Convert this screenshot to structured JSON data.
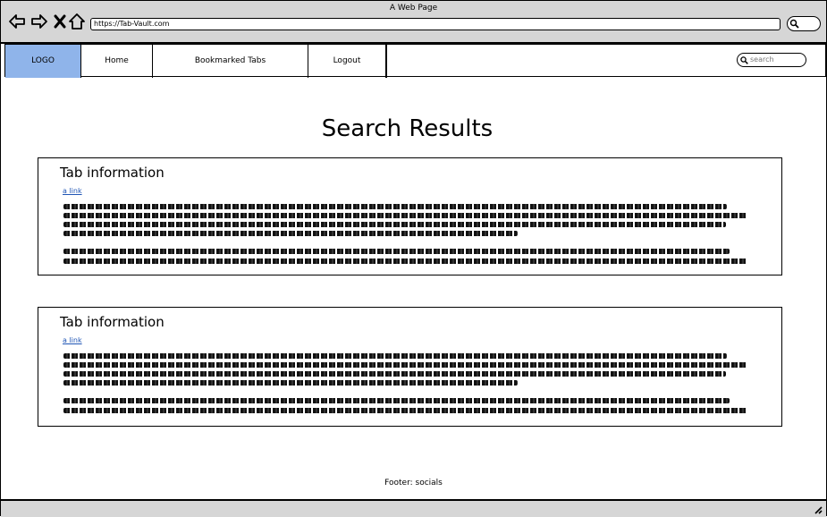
{
  "window": {
    "title": "A Web Page",
    "url": "https://Tab-Vault.com"
  },
  "nav": {
    "logo": "LOGO",
    "home": "Home",
    "bookmarked": "Bookmarked Tabs",
    "logout": "Logout",
    "search_placeholder": "search"
  },
  "main": {
    "title": "Search Results",
    "cards": [
      {
        "title": "Tab information",
        "link": "a link"
      },
      {
        "title": "Tab information",
        "link": "a link"
      }
    ]
  },
  "footer": {
    "text": "Footer: socials"
  },
  "colors": {
    "logo_bg": "#8fb4ea",
    "link": "#1f55b5",
    "chrome": "#d6d6d6"
  }
}
